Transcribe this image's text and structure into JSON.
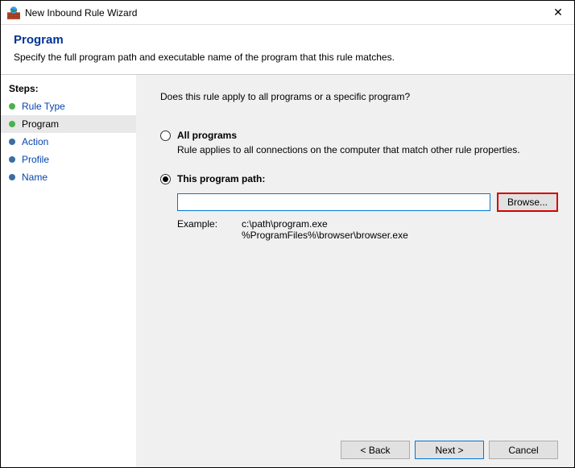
{
  "window": {
    "title": "New Inbound Rule Wizard",
    "close_label": "✕"
  },
  "header": {
    "page_title": "Program",
    "description": "Specify the full program path and executable name of the program that this rule matches."
  },
  "sidebar": {
    "section_title": "Steps:",
    "steps": [
      {
        "label": "Rule Type",
        "done": true,
        "current": false,
        "clickable": true
      },
      {
        "label": "Program",
        "done": true,
        "current": true,
        "clickable": false
      },
      {
        "label": "Action",
        "done": false,
        "current": false,
        "clickable": true
      },
      {
        "label": "Profile",
        "done": false,
        "current": false,
        "clickable": true
      },
      {
        "label": "Name",
        "done": false,
        "current": false,
        "clickable": true
      }
    ]
  },
  "main": {
    "question": "Does this rule apply to all programs or a specific program?",
    "option_all": {
      "label": "All programs",
      "description": "Rule applies to all connections on the computer that match other rule properties."
    },
    "option_path": {
      "label": "This program path:",
      "value": "",
      "browse_label": "Browse...",
      "example_label": "Example:",
      "example_lines": "c:\\path\\program.exe\n%ProgramFiles%\\browser\\browser.exe"
    },
    "selected": "path"
  },
  "footer": {
    "back_label": "< Back",
    "next_label": "Next >",
    "cancel_label": "Cancel"
  }
}
